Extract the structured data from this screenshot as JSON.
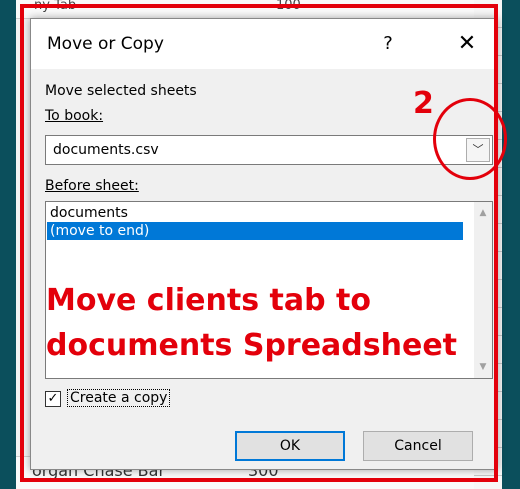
{
  "background_sheet": {
    "top_row_text": "ny Tab",
    "top_row_value": "100",
    "bottom_row_text": "organ Chase Bar",
    "bottom_row_value": "300"
  },
  "dialog": {
    "title": "Move or Copy",
    "help_label": "?",
    "close_label": "✕",
    "section_label": "Move selected sheets",
    "to_book_label": "To book:",
    "to_book_value": "documents.csv",
    "dropdown_arrow": "﹀",
    "before_sheet_label": "Before sheet:",
    "sheets": [
      {
        "label": "documents",
        "selected": false
      },
      {
        "label": "(move to end)",
        "selected": true
      }
    ],
    "scroll_up": "▲",
    "scroll_down": "▼",
    "create_copy_checked": true,
    "create_copy_check": "☑",
    "create_copy_label": "Create a copy",
    "ok_label": "OK",
    "cancel_label": "Cancel"
  },
  "annotation": {
    "step_number": "2",
    "instruction_line1": "Move clients tab to",
    "instruction_line2": "documents Spreadsheet",
    "color": "#e3000b"
  }
}
